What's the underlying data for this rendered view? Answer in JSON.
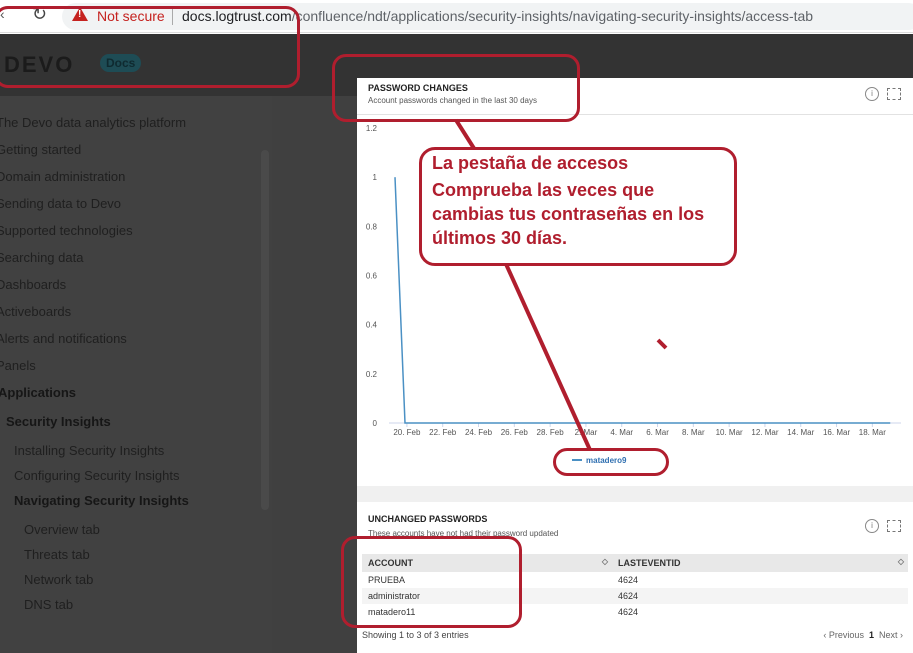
{
  "browser": {
    "security_label": "Not secure",
    "url_host": "docs.logtrust.com",
    "url_path": "/confluence/ndt/applications/security-insights/navigating-security-insights/access-tab"
  },
  "site": {
    "logo": "DEVO",
    "badge": "Docs"
  },
  "sidebar": {
    "items": [
      "The Devo data analytics platform",
      "Getting started",
      "Domain administration",
      "Sending data to Devo",
      "Supported technologies",
      "Searching data",
      "Dashboards",
      "Activeboards",
      "Alerts and notifications",
      "Panels",
      "Applications",
      "Security Insights",
      "Installing Security Insights",
      "Configuring Security Insights",
      "Navigating Security Insights",
      "Overview tab",
      "Threats tab",
      "Network tab",
      "DNS tab"
    ]
  },
  "password_changes": {
    "title": "PASSWORD CHANGES",
    "subtitle": "Account passwords changed in the last 30 days"
  },
  "unchanged_passwords": {
    "title": "UNCHANGED PASSWORDS",
    "subtitle": "These accounts have not had their password updated",
    "columns": [
      "ACCOUNT",
      "LASTEVENTID"
    ],
    "rows": [
      [
        "PRUEBA",
        "4624"
      ],
      [
        "administrator",
        "4624"
      ],
      [
        "matadero11",
        "4624"
      ]
    ],
    "showing": "Showing 1 to 3 of 3 entries",
    "pager": {
      "previous": "Previous",
      "page": "1",
      "next": "Next"
    }
  },
  "annotation": {
    "heading": "La pestaña de accesos",
    "body": "Comprueba las veces que cambias tus contraseñas en los últimos 30 días."
  },
  "colors": {
    "annotation": "#b01e2e",
    "series": "#4a90c4",
    "legend_text": "#2f6fb0"
  },
  "chart_data": {
    "type": "line",
    "ylim": [
      0,
      1.2
    ],
    "yticks": [
      0,
      0.2,
      0.4,
      0.6,
      0.8,
      1,
      1.2
    ],
    "ytick_labels": [
      "0",
      "0.2",
      "0.4",
      "0.6",
      "0.8",
      "1",
      "1.2"
    ],
    "xtick_labels": [
      "20. Feb",
      "22. Feb",
      "24. Feb",
      "26. Feb",
      "28. Feb",
      "2. Mar",
      "4. Mar",
      "6. Mar",
      "8. Mar",
      "10. Mar",
      "12. Mar",
      "14. Mar",
      "16. Mar",
      "18. Mar"
    ],
    "x": [
      "2019-02-19",
      "2019-02-20",
      "2019-03-19"
    ],
    "series": [
      {
        "name": "matadero9",
        "values": [
          1,
          0,
          0
        ]
      }
    ]
  }
}
